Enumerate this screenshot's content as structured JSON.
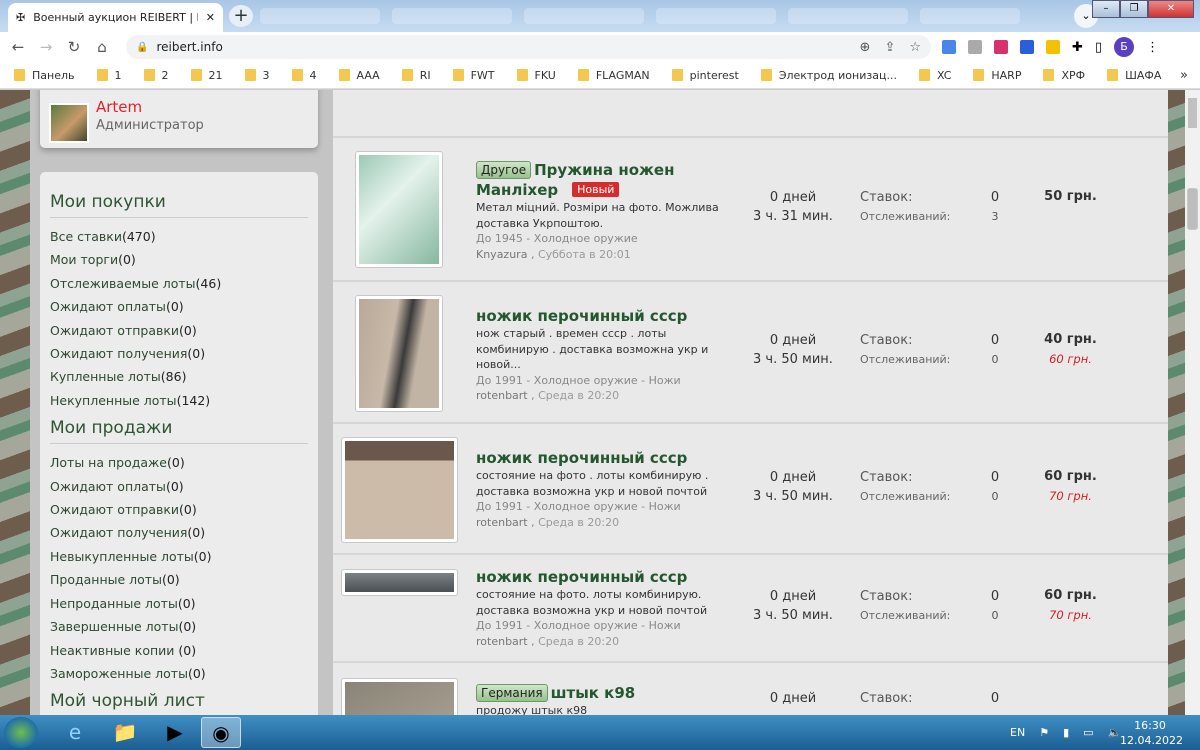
{
  "browser": {
    "tab_title": "Военный аукцион REIBERT | REI",
    "url": "reibert.info",
    "bookmarks": [
      "Панель",
      "1",
      "2",
      "21",
      "3",
      "4",
      "AAA",
      "RI",
      "FWT",
      "FKU",
      "FLAGMAN",
      "pinterest",
      "Электрод ионизац...",
      "XC",
      "HARP",
      "ХРФ",
      "ШАФА"
    ],
    "profile_initial": "Б"
  },
  "user": {
    "name": "Artem",
    "role": "Администратор"
  },
  "sidebar": {
    "purchases_title": "Мои покупки",
    "purchases": [
      {
        "label": "Все ставки",
        "count": "(470)"
      },
      {
        "label": "Мои торги",
        "count": "(0)"
      },
      {
        "label": "Отслеживаемые лоты",
        "count": "(46)"
      },
      {
        "label": "Ожидают оплаты",
        "count": "(0)"
      },
      {
        "label": "Ожидают отправки",
        "count": "(0)"
      },
      {
        "label": "Ожидают получения",
        "count": "(0)"
      },
      {
        "label": "Купленные лоты",
        "count": "(86)"
      },
      {
        "label": "Некупленные лоты",
        "count": "(142)"
      }
    ],
    "sales_title": "Мои продажи",
    "sales": [
      {
        "label": "Лоты на продаже",
        "count": "(0)"
      },
      {
        "label": "Ожидают оплаты",
        "count": "(0)"
      },
      {
        "label": "Ожидают отправки",
        "count": "(0)"
      },
      {
        "label": "Ожидают получения",
        "count": "(0)"
      },
      {
        "label": "Невыкупленные лоты",
        "count": "(0)"
      },
      {
        "label": "Проданные лоты",
        "count": "(0)"
      },
      {
        "label": "Непроданные лоты",
        "count": "(0)"
      },
      {
        "label": "Завершенные лоты",
        "count": "(0)"
      },
      {
        "label": "Неактивные копии ",
        "count": "(0)"
      },
      {
        "label": "Замороженные лоты",
        "count": "(0)"
      }
    ],
    "next_title": "Мой чорный лист"
  },
  "labels": {
    "bids": "Ставок:",
    "watches": "Отслеживаний:"
  },
  "lots": [
    {
      "category": "",
      "title": "",
      "is_new": false,
      "description": "",
      "section": "До 1945 - Холодное оружие",
      "seller": "Knyazura",
      "date": "Суббота в 20:01",
      "days": "",
      "time": "",
      "bids": "",
      "watches": "",
      "price": "",
      "buy_now": ""
    },
    {
      "category": "Другое",
      "title": "Пружина ножен Манліхер",
      "is_new": true,
      "new_label": "Новый",
      "description": "Метал міцний. Розміри на фото. Можлива доставка Укрпоштою.",
      "section": "До 1945 - Холодное оружие",
      "seller": "Knyazura",
      "date": "Суббота в 20:01",
      "days": "0 дней",
      "time": "3 ч. 31 мин.",
      "bids": "0",
      "watches": "3",
      "price": "50 грн.",
      "buy_now": ""
    },
    {
      "category": "",
      "title": "ножик перочинный ссср",
      "is_new": false,
      "description": "нож старый . времен ссср . лоты комбинирую . доставка возможна укр и новой...",
      "section": "До 1991 - Холодное оружие - Ножи",
      "seller": "rotenbart",
      "date": "Среда в 20:20",
      "days": "0 дней",
      "time": "3 ч. 50 мин.",
      "bids": "0",
      "watches": "0",
      "price": "40 грн.",
      "buy_now": "60 грн."
    },
    {
      "category": "",
      "title": "ножик перочинный ссср",
      "is_new": false,
      "description": "состояние на фото . лоты комбинирую . доставка возможна укр и новой почтой",
      "section": "До 1991 - Холодное оружие - Ножи",
      "seller": "rotenbart",
      "date": "Среда в 20:20",
      "days": "0 дней",
      "time": "3 ч. 50 мин.",
      "bids": "0",
      "watches": "0",
      "price": "60 грн.",
      "buy_now": "70 грн."
    },
    {
      "category": "",
      "title": "ножик перочинный ссср",
      "is_new": false,
      "description": "состояние на фото. лоты комбинирую. доставка возможна укр и новой почтой",
      "section": "До 1991 - Холодное оружие - Ножи",
      "seller": "rotenbart",
      "date": "Среда в 20:20",
      "days": "0 дней",
      "time": "3 ч. 50 мин.",
      "bids": "0",
      "watches": "0",
      "price": "60 грн.",
      "buy_now": "70 грн."
    },
    {
      "category": "Германия",
      "title": "штык к98",
      "is_new": false,
      "description": "продожу штык к98",
      "section": "",
      "seller": "",
      "date": "",
      "days": "0 дней",
      "time": "",
      "bids": "0",
      "watches": "",
      "price": "",
      "buy_now": ""
    }
  ],
  "taskbar": {
    "lang": "EN",
    "time": "16:30",
    "date": "12.04.2022"
  }
}
